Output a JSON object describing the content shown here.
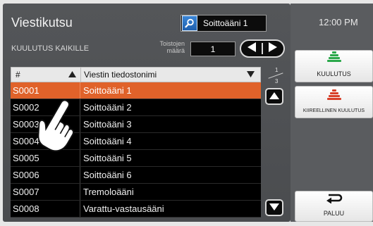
{
  "header": {
    "title": "Viestikutsu",
    "subtitle": "KUULUTUS KAIKILLE",
    "search_value": "Soittoääni 1",
    "repeat_label_line1": "Toistojen",
    "repeat_label_line2": "määrä",
    "repeat_value": "1",
    "time": "12:00 PM"
  },
  "table": {
    "col_number": "#",
    "col_filename": "Viestin tiedostonimi",
    "rows": [
      {
        "id": "S0001",
        "name": "Soittoääni 1",
        "selected": true
      },
      {
        "id": "S0002",
        "name": "Soittoääni 2"
      },
      {
        "id": "S0003",
        "name": "Soittoääni 3"
      },
      {
        "id": "S0004",
        "name": "Soittoääni 4"
      },
      {
        "id": "S0005",
        "name": "Soittoääni 5"
      },
      {
        "id": "S0006",
        "name": "Soittoääni 6"
      },
      {
        "id": "S0007",
        "name": "Tremoloääni"
      },
      {
        "id": "S0008",
        "name": "Varattu-vastausääni"
      }
    ]
  },
  "pager": {
    "current": "1",
    "total": "3"
  },
  "buttons": {
    "announce": "KUULUTUS",
    "urgent": "KIIREELLINEN KUULUTUS",
    "back": "PALUU"
  },
  "colors": {
    "selected_row": "#e0622a",
    "icon_green": "#2aa84a",
    "icon_red": "#d8402a",
    "search_blue": "#2a6fc4"
  },
  "icons": {
    "search": "search-icon",
    "announce": "speaker-green-icon",
    "urgent": "speaker-red-icon",
    "back": "return-arrow-icon",
    "hand": "tap-hand-icon"
  }
}
